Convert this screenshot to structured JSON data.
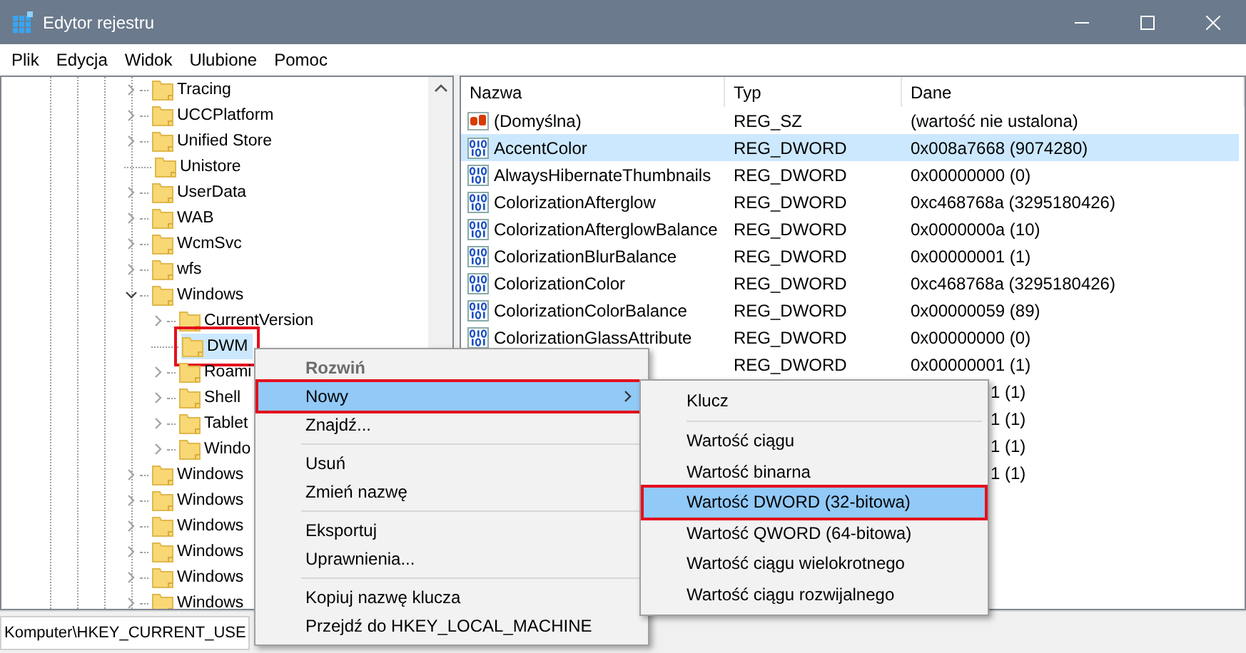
{
  "window": {
    "title": "Edytor rejestru"
  },
  "menu_bar": [
    "Plik",
    "Edycja",
    "Widok",
    "Ulubione",
    "Pomoc"
  ],
  "tree": [
    {
      "label": "Tracing",
      "kind": "branch",
      "expanded": false,
      "selected": false,
      "outlined": false
    },
    {
      "label": "UCCPlatform",
      "kind": "branch",
      "expanded": false,
      "selected": false,
      "outlined": false
    },
    {
      "label": "Unified Store",
      "kind": "branch",
      "expanded": false,
      "selected": false,
      "outlined": false
    },
    {
      "label": "Unistore",
      "kind": "leaf",
      "selected": false,
      "outlined": false
    },
    {
      "label": "UserData",
      "kind": "branch",
      "expanded": false,
      "selected": false,
      "outlined": false
    },
    {
      "label": "WAB",
      "kind": "branch",
      "expanded": false,
      "selected": false,
      "outlined": false
    },
    {
      "label": "WcmSvc",
      "kind": "branch",
      "expanded": false,
      "selected": false,
      "outlined": false
    },
    {
      "label": "wfs",
      "kind": "branch",
      "expanded": false,
      "selected": false,
      "outlined": false
    },
    {
      "label": "Windows",
      "kind": "branch",
      "expanded": true,
      "selected": false,
      "outlined": false,
      "children": [
        {
          "label": "CurrentVersion",
          "kind": "branch",
          "expanded": false,
          "selected": false,
          "outlined": false
        },
        {
          "label": "DWM",
          "kind": "leaf",
          "selected": true,
          "outlined": true
        },
        {
          "label": "Roami",
          "kind": "branch",
          "expanded": false,
          "selected": false,
          "outlined": false
        },
        {
          "label": "Shell",
          "kind": "branch",
          "expanded": false,
          "selected": false,
          "outlined": false
        },
        {
          "label": "Tablet",
          "kind": "branch",
          "expanded": false,
          "selected": false,
          "outlined": false
        },
        {
          "label": "Windo",
          "kind": "branch",
          "expanded": false,
          "selected": false,
          "outlined": false
        }
      ]
    },
    {
      "label": "Windows",
      "kind": "branch",
      "expanded": false,
      "selected": false,
      "outlined": false
    },
    {
      "label": "Windows",
      "kind": "branch",
      "expanded": false,
      "selected": false,
      "outlined": false
    },
    {
      "label": "Windows",
      "kind": "branch",
      "expanded": false,
      "selected": false,
      "outlined": false
    },
    {
      "label": "Windows",
      "kind": "branch",
      "expanded": false,
      "selected": false,
      "outlined": false
    },
    {
      "label": "Windows",
      "kind": "branch",
      "expanded": false,
      "selected": false,
      "outlined": false
    },
    {
      "label": "Windows",
      "kind": "branch",
      "expanded": false,
      "selected": false,
      "outlined": false
    }
  ],
  "values": {
    "columns": [
      "Nazwa",
      "Typ",
      "Dane"
    ],
    "rows": [
      {
        "kind": "string",
        "name": "(Domyślna)",
        "type": "REG_SZ",
        "data": "(wartość nie ustalona)",
        "selected": false
      },
      {
        "kind": "dword",
        "name": "AccentColor",
        "type": "REG_DWORD",
        "data": "0x008a7668 (9074280)",
        "selected": true
      },
      {
        "kind": "dword",
        "name": "AlwaysHibernateThumbnails",
        "type": "REG_DWORD",
        "data": "0x00000000 (0)",
        "selected": false
      },
      {
        "kind": "dword",
        "name": "ColorizationAfterglow",
        "type": "REG_DWORD",
        "data": "0xc468768a (3295180426)",
        "selected": false
      },
      {
        "kind": "dword",
        "name": "ColorizationAfterglowBalance",
        "type": "REG_DWORD",
        "data": "0x0000000a (10)",
        "selected": false
      },
      {
        "kind": "dword",
        "name": "ColorizationBlurBalance",
        "type": "REG_DWORD",
        "data": "0x00000001 (1)",
        "selected": false
      },
      {
        "kind": "dword",
        "name": "ColorizationColor",
        "type": "REG_DWORD",
        "data": "0xc468768a (3295180426)",
        "selected": false
      },
      {
        "kind": "dword",
        "name": "ColorizationColorBalance",
        "type": "REG_DWORD",
        "data": "0x00000059 (89)",
        "selected": false
      },
      {
        "kind": "dword",
        "name": "ColorizationGlassAttribute",
        "type": "REG_DWORD",
        "data": "0x00000000 (0)",
        "selected": false
      },
      {
        "type": "REG_DWORD",
        "data": "0x00000001 (1)",
        "selected": false
      },
      {
        "data": "1 (1)",
        "selected": false
      },
      {
        "data": "1 (1)",
        "selected": false
      },
      {
        "data": "1 (1)",
        "selected": false
      },
      {
        "data": "1 (1)",
        "selected": false
      }
    ]
  },
  "status_bar": "Komputer\\HKEY_CURRENT_USE",
  "context_menu": {
    "groups": [
      [
        {
          "label": "Rozwiń",
          "default": true,
          "disabled": true,
          "selected": false,
          "submenu": false,
          "outlined": false
        },
        {
          "label": "Nowy",
          "default": false,
          "disabled": false,
          "selected": true,
          "submenu": true,
          "outlined": true
        },
        {
          "label": "Znajdź...",
          "default": false,
          "disabled": false,
          "selected": false,
          "submenu": false,
          "outlined": false
        }
      ],
      [
        {
          "label": "Usuń",
          "default": false,
          "disabled": false,
          "selected": false,
          "submenu": false,
          "outlined": false
        },
        {
          "label": "Zmień nazwę",
          "default": false,
          "disabled": false,
          "selected": false,
          "submenu": false,
          "outlined": false
        }
      ],
      [
        {
          "label": "Eksportuj",
          "default": false,
          "disabled": false,
          "selected": false,
          "submenu": false,
          "outlined": false
        },
        {
          "label": "Uprawnienia...",
          "default": false,
          "disabled": false,
          "selected": false,
          "submenu": false,
          "outlined": false
        }
      ],
      [
        {
          "label": "Kopiuj nazwę klucza",
          "default": false,
          "disabled": false,
          "selected": false,
          "submenu": false,
          "outlined": false
        },
        {
          "label": "Przejdź do HKEY_LOCAL_MACHINE",
          "default": false,
          "disabled": false,
          "selected": false,
          "submenu": false,
          "outlined": false
        }
      ]
    ]
  },
  "submenu": {
    "groups": [
      [
        {
          "label": "Klucz",
          "selected": false,
          "outlined": false
        }
      ],
      [
        {
          "label": "Wartość ciągu",
          "selected": false,
          "outlined": false
        },
        {
          "label": "Wartość binarna",
          "selected": false,
          "outlined": false
        },
        {
          "label": "Wartość DWORD (32-bitowa)",
          "selected": true,
          "outlined": true
        },
        {
          "label": "Wartość QWORD (64-bitowa)",
          "selected": false,
          "outlined": false
        },
        {
          "label": "Wartość ciągu wielokrotnego",
          "selected": false,
          "outlined": false
        },
        {
          "label": "Wartość ciągu rozwijalnego",
          "selected": false,
          "outlined": false
        }
      ]
    ]
  }
}
